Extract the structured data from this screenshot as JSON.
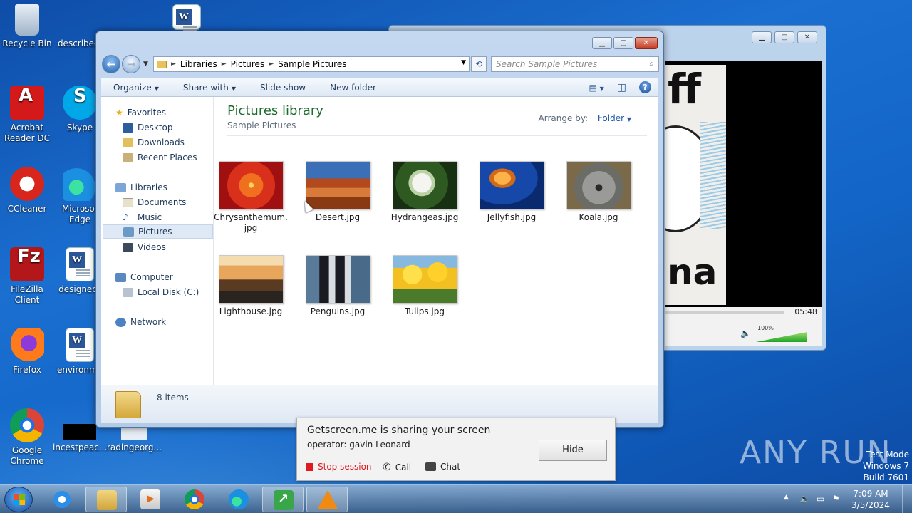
{
  "desktop": {
    "icons": [
      {
        "label": "Recycle Bin",
        "icon": "recycle-bin-icon"
      },
      {
        "label": "describede",
        "icon": "word-document-icon"
      },
      {
        "label": "Acrobat Reader DC",
        "icon": "acrobat-icon"
      },
      {
        "label": "Skype",
        "icon": "skype-icon"
      },
      {
        "label": "CCleaner",
        "icon": "ccleaner-icon"
      },
      {
        "label": "Microsof Edge",
        "icon": "edge-icon"
      },
      {
        "label": "FileZilla Client",
        "icon": "filezilla-icon"
      },
      {
        "label": "designedr",
        "icon": "word-document-icon"
      },
      {
        "label": "Firefox",
        "icon": "firefox-icon"
      },
      {
        "label": "environme",
        "icon": "word-document-icon"
      },
      {
        "label": "Google Chrome",
        "icon": "chrome-icon"
      },
      {
        "label": "incestpeac...",
        "icon": "black-file-icon"
      },
      {
        "label": "radingeorg...",
        "icon": "document-icon"
      }
    ]
  },
  "player": {
    "time": "05:48",
    "volume": "100%",
    "volume_level": 1.0,
    "art_top": "ff",
    "art_bottom": "na"
  },
  "explorer": {
    "breadcrumb": [
      "Libraries",
      "Pictures",
      "Sample Pictures"
    ],
    "search_placeholder": "Search Sample Pictures",
    "commands": {
      "organize": "Organize",
      "share_with": "Share with",
      "slide_show": "Slide show",
      "new_folder": "New folder"
    },
    "nav": {
      "favorites": "Favorites",
      "desktop": "Desktop",
      "downloads": "Downloads",
      "recent_places": "Recent Places",
      "libraries": "Libraries",
      "documents": "Documents",
      "music": "Music",
      "pictures": "Pictures",
      "videos": "Videos",
      "computer": "Computer",
      "local_disk": "Local Disk (C:)",
      "network": "Network"
    },
    "library_title": "Pictures library",
    "library_subtitle": "Sample Pictures",
    "arrange_label": "Arrange by:",
    "arrange_value": "Folder",
    "files": [
      {
        "name": "Chrysanthemum.jpg",
        "line1": "Chrysanthemum.",
        "line2": "jpg"
      },
      {
        "name": "Desert.jpg"
      },
      {
        "name": "Hydrangeas.jpg"
      },
      {
        "name": "Jellyfish.jpg"
      },
      {
        "name": "Koala.jpg"
      },
      {
        "name": "Lighthouse.jpg"
      },
      {
        "name": "Penguins.jpg"
      },
      {
        "name": "Tulips.jpg"
      }
    ],
    "item_count": "8 items"
  },
  "getscreen": {
    "message": "Getscreen.me is sharing your screen",
    "operator": "operator: gavin Leonard",
    "stop_session": "Stop session",
    "call": "Call",
    "chat": "Chat",
    "hide": "Hide"
  },
  "watermark": {
    "brand": "ANY RUN",
    "line1": "Test Mode",
    "line2": "Windows 7",
    "line3": "Build 7601"
  },
  "taskbar": {
    "apps": [
      "internet-explorer-icon",
      "windows-explorer-icon",
      "media-player-icon",
      "chrome-icon",
      "edge-icon",
      "getscreen-icon",
      "vlc-icon"
    ],
    "time": "7:09 AM",
    "date": "3/5/2024"
  },
  "colors": {
    "desktop_bg": "#1366c8",
    "library_title": "#1e6b2d",
    "stop_red": "#e0191f"
  }
}
